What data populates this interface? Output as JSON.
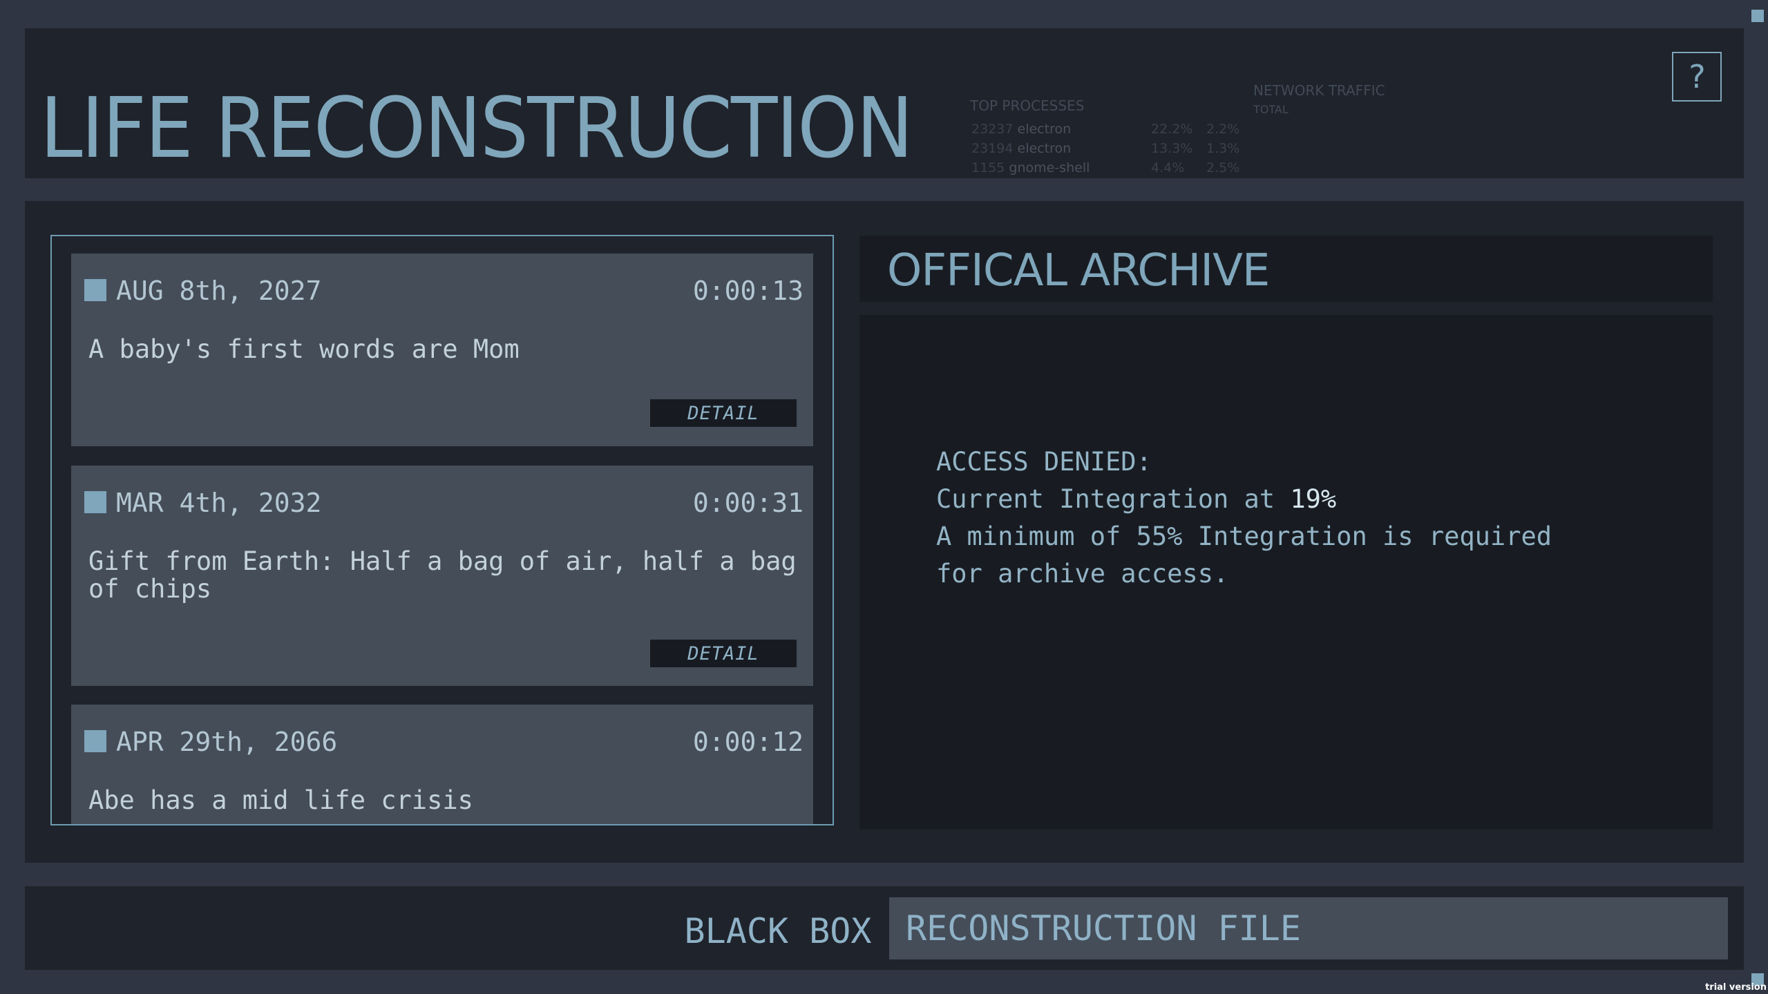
{
  "header": {
    "title": "LIFE RECONSTRUCTION",
    "help_label": "?",
    "system_monitor": {
      "top_processes_label": "TOP PROCESSES",
      "network_traffic_label": "NETWORK TRAFFIC",
      "total_label": "TOTAL",
      "processes": [
        {
          "pid": "23237",
          "name": "electron",
          "cpu": "22.2%",
          "mem": "2.2%"
        },
        {
          "pid": "23194",
          "name": "electron",
          "cpu": "13.3%",
          "mem": "1.3%"
        },
        {
          "pid": "1155",
          "name": "gnome-shell",
          "cpu": "4.4%",
          "mem": "2.5%"
        }
      ]
    }
  },
  "events": [
    {
      "date": "AUG 8th, 2027",
      "time": "0:00:13",
      "description": "A baby's first words are Mom",
      "detail_label": "DETAIL"
    },
    {
      "date": "MAR 4th, 2032",
      "time": "0:00:31",
      "description": "Gift from Earth: Half a bag of air, half a bag\nof chips",
      "detail_label": "DETAIL"
    },
    {
      "date": "APR 29th, 2066",
      "time": "0:00:12",
      "description": "Abe has a mid life crisis"
    }
  ],
  "archive": {
    "title": "OFFICAL ARCHIVE",
    "line1": "ACCESS DENIED:",
    "line2_prefix": "Current Integration at ",
    "integration_value": "19%",
    "line3": "A minimum of 55% Integration is required",
    "line4": "for archive access."
  },
  "footer": {
    "tab_black_box": "BLACK BOX",
    "tab_reconstruction_file": "RECONSTRUCTION FILE"
  },
  "watermark": "trial version",
  "colors": {
    "background": "#2f3542",
    "panel": "#1f232b",
    "card": "#454d59",
    "accent": "#7fa6bb"
  }
}
